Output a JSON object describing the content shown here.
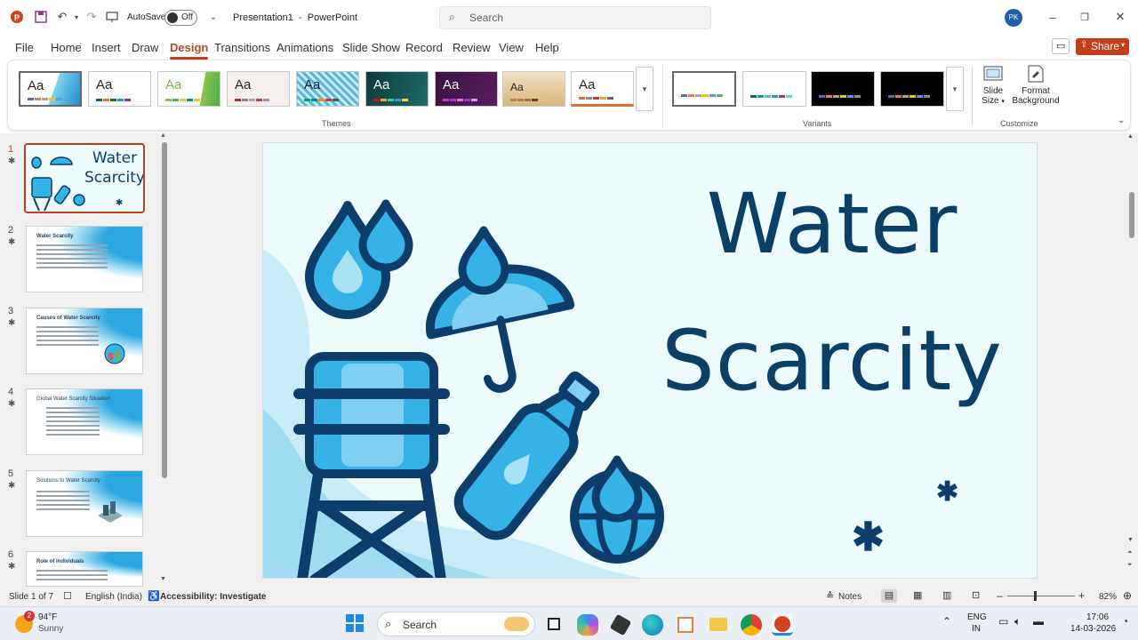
{
  "titlebar": {
    "autosave_label": "AutoSave",
    "autosave_state": "Off",
    "doc_title": "Presentation1  -  PowerPoint",
    "search_placeholder": "Search",
    "user_initials": "PK"
  },
  "menu": {
    "items": [
      "File",
      "Home",
      "Insert",
      "Draw",
      "Design",
      "Transitions",
      "Animations",
      "Slide Show",
      "Record",
      "Review",
      "View",
      "Help"
    ],
    "active": "Design",
    "share_label": "Share"
  },
  "ribbon": {
    "themes_label": "Themes",
    "variants_label": "Variants",
    "customize_label": "Customize",
    "slide_size_label": "Slide",
    "slide_size_label2": "Size",
    "format_bg_label": "Format",
    "format_bg_label2": "Background",
    "theme_sample": "Aa"
  },
  "slides": [
    {
      "num": "1",
      "title": "Water Scarcity"
    },
    {
      "num": "2",
      "title": "Water Scarcity"
    },
    {
      "num": "3",
      "title": "Causes of Water Scarcity"
    },
    {
      "num": "4",
      "title": "Global Water Scarcity Situation"
    },
    {
      "num": "5",
      "title": "Solutions to Water Scarcity"
    },
    {
      "num": "6",
      "title": "Role of Individuals"
    }
  ],
  "main_slide": {
    "title_line1": "Water",
    "title_line2": "Scarcity"
  },
  "status": {
    "slide_counter": "Slide 1 of 7",
    "language": "English (India)",
    "accessibility": "Accessibility: Investigate",
    "notes": "Notes",
    "zoom": "82%"
  },
  "taskbar": {
    "weather_temp": "94°F",
    "weather_desc": "Sunny",
    "weather_badge": "2",
    "search_label": "Search",
    "lang1": "ENG",
    "lang2": "IN",
    "time": "17:06",
    "date": "14-03-2026"
  },
  "colors": {
    "accent": "#c43e1c",
    "slide_bg": "#eefbfd",
    "title_color": "#0a4067",
    "water_blue": "#35b2e6",
    "dark_navy": "#0d3d6b"
  }
}
